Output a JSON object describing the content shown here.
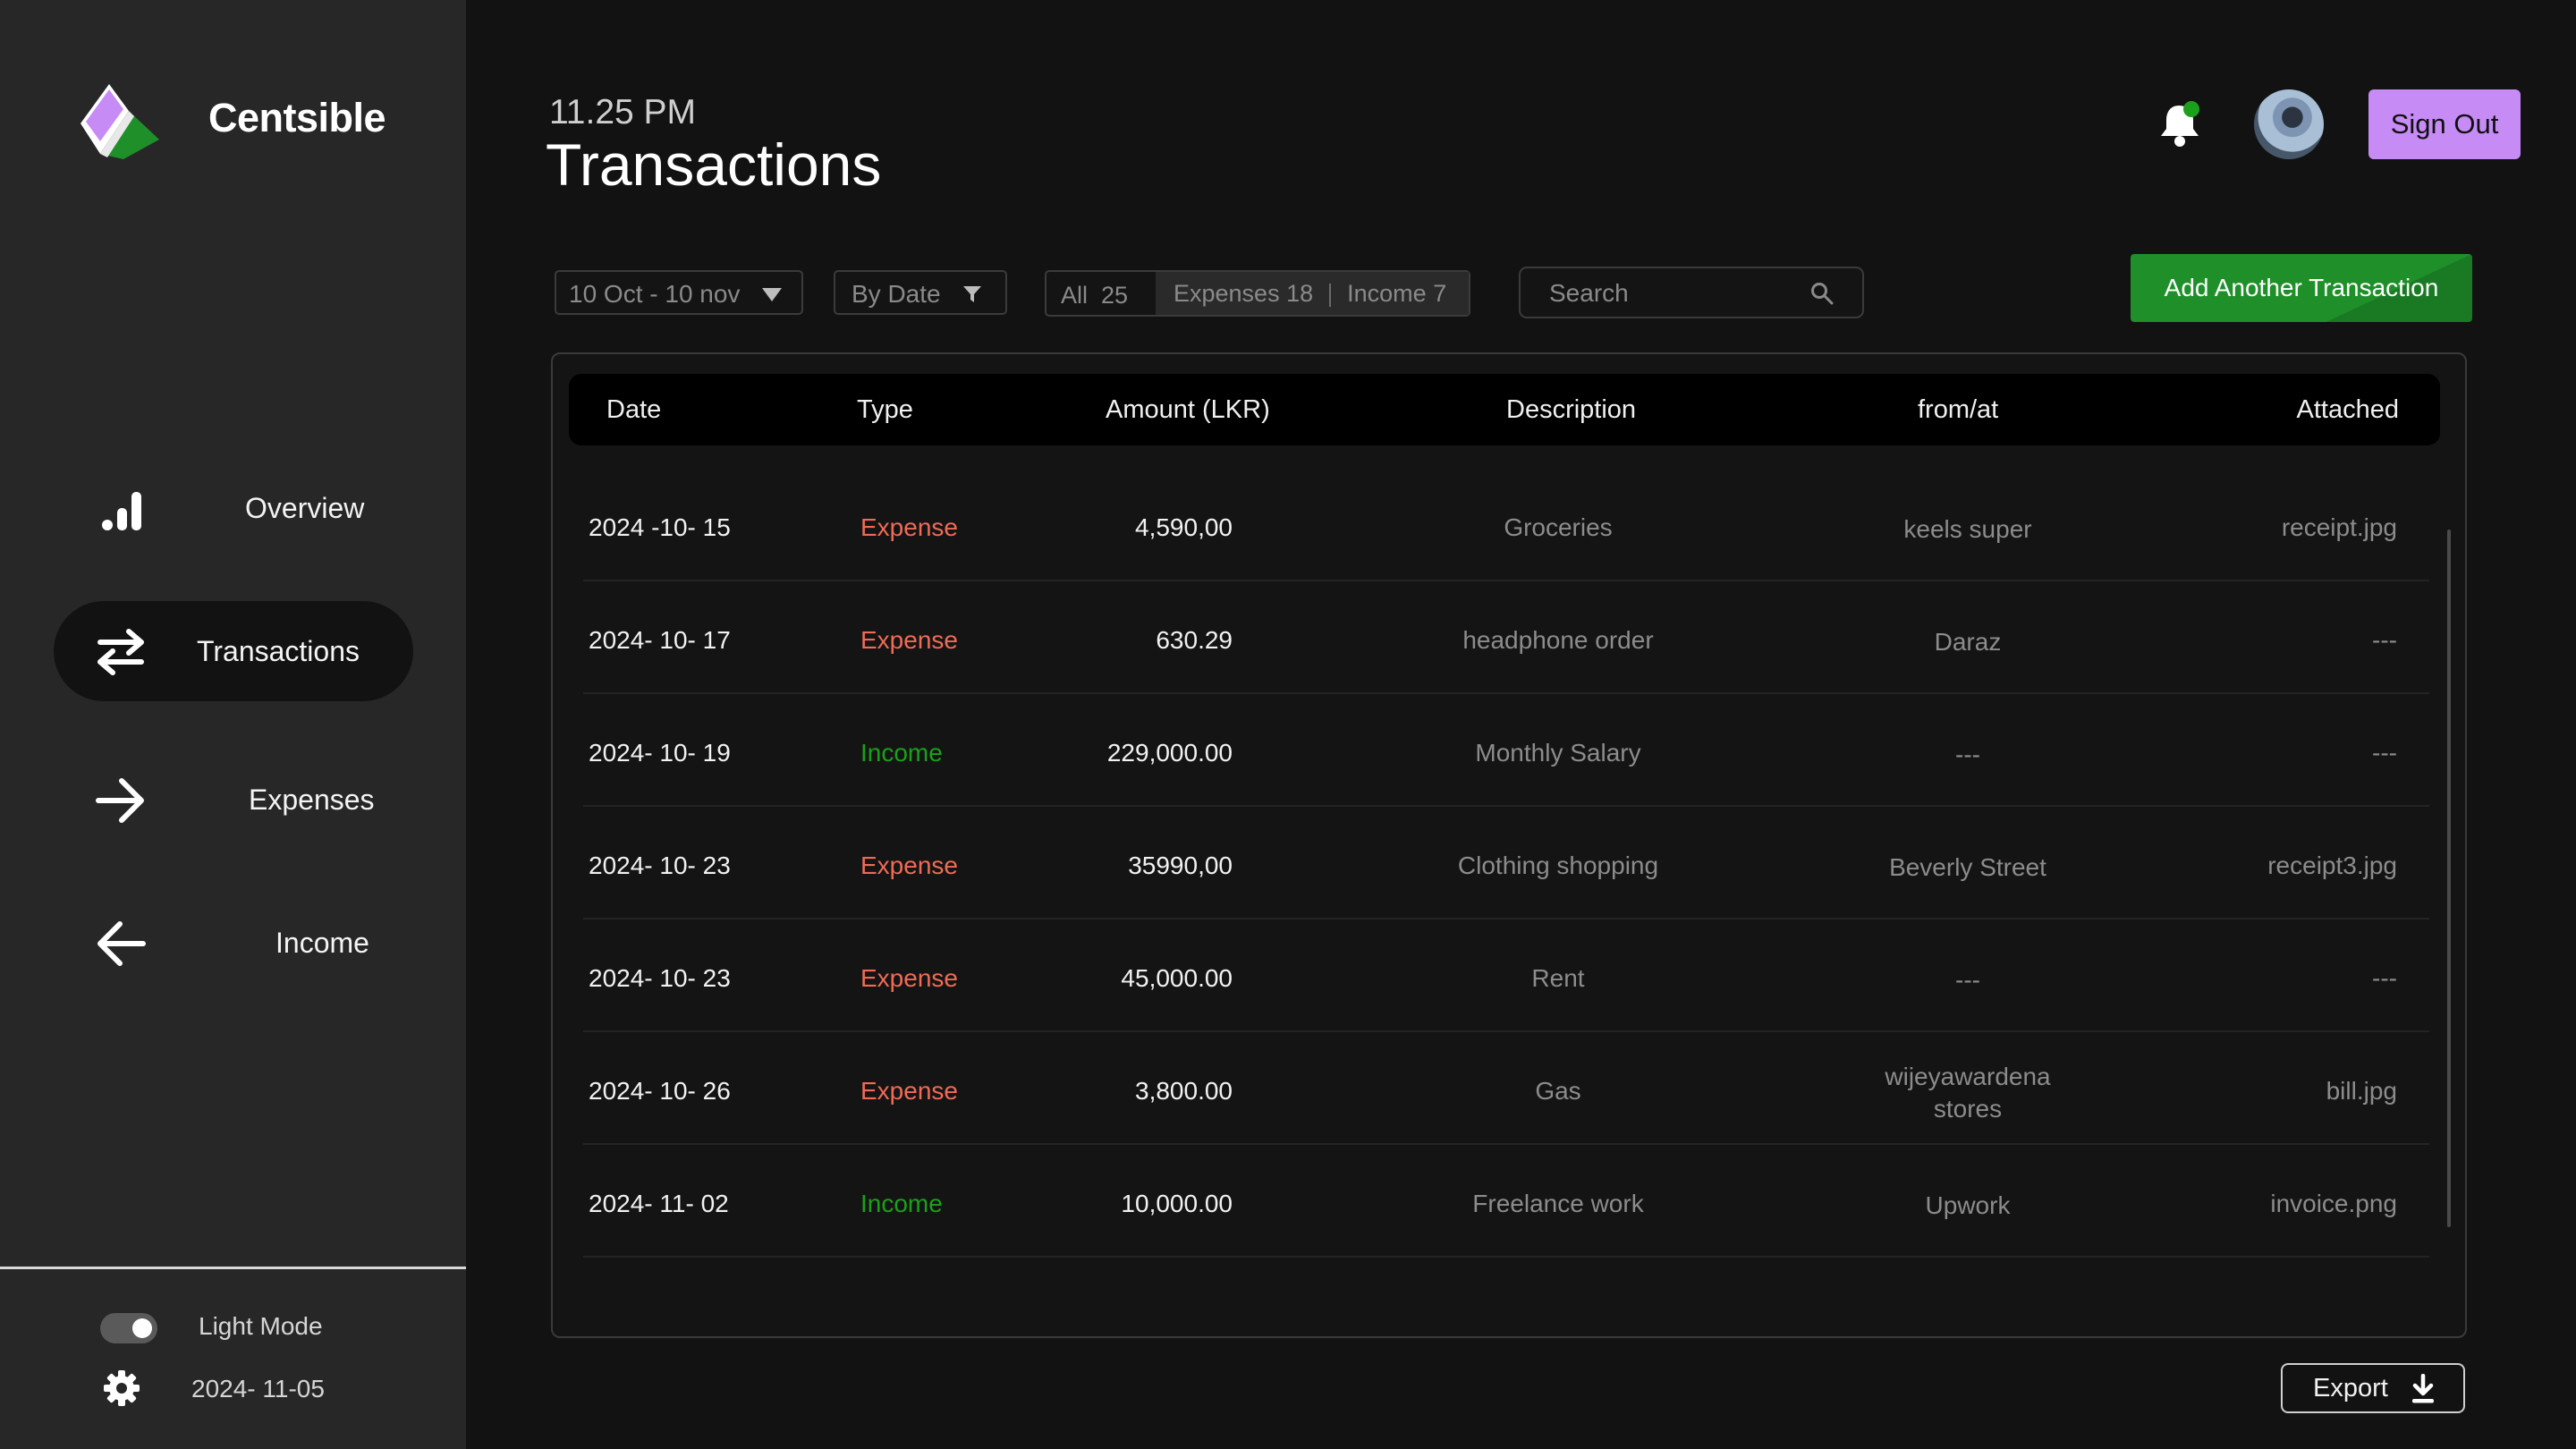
{
  "app": {
    "name": "Centsible"
  },
  "sidebar": {
    "nav": [
      {
        "label": "Overview",
        "icon": "bar-chart-icon"
      },
      {
        "label": "Transactions",
        "icon": "swap-arrows-icon",
        "active": true
      },
      {
        "label": "Expenses",
        "icon": "arrow-right-icon"
      },
      {
        "label": "Income",
        "icon": "arrow-left-icon"
      }
    ],
    "mode_label": "Light Mode",
    "date": "2024- 11-05"
  },
  "header": {
    "time": "11.25 PM",
    "title": "Transactions",
    "sign_out": "Sign Out"
  },
  "filters": {
    "date_range": "10 Oct - 10 nov",
    "sort": "By Date",
    "segments": {
      "all_label": "All",
      "all_count": "25",
      "expenses_label": "Expenses",
      "expenses_count": "18",
      "income_label": "Income",
      "income_count": "7"
    },
    "search_placeholder": "Search",
    "add_button": "Add Another Transaction"
  },
  "table": {
    "headers": {
      "date": "Date",
      "type": "Type",
      "amount": "Amount (LKR)",
      "description": "Description",
      "from": "from/at",
      "attached": "Attached"
    },
    "rows": [
      {
        "date": "2024 -10- 15",
        "type": "Expense",
        "amount": "4,590,00",
        "description": "Groceries",
        "from": "keels super",
        "attached": "receipt.jpg"
      },
      {
        "date": "2024- 10- 17",
        "type": "Expense",
        "amount": "630.29",
        "description": "headphone order",
        "from": "Daraz",
        "attached": "---"
      },
      {
        "date": "2024- 10- 19",
        "type": "Income",
        "amount": "229,000.00",
        "description": "Monthly Salary",
        "from": "---",
        "attached": "---"
      },
      {
        "date": "2024- 10- 23",
        "type": "Expense",
        "amount": "35990,00",
        "description": "Clothing shopping",
        "from": "Beverly Street",
        "attached": "receipt3.jpg"
      },
      {
        "date": "2024- 10- 23",
        "type": "Expense",
        "amount": "45,000.00",
        "description": "Rent",
        "from": "---",
        "attached": "---"
      },
      {
        "date": "2024- 10- 26",
        "type": "Expense",
        "amount": "3,800.00",
        "description": "Gas",
        "from": "wijeyawardena stores",
        "attached": "bill.jpg"
      },
      {
        "date": "2024- 11- 02",
        "type": "Income",
        "amount": "10,000.00",
        "description": "Freelance work",
        "from": "Upwork",
        "attached": "invoice.png"
      }
    ]
  },
  "export_label": "Export",
  "colors": {
    "accent_green": "#1f8f2a",
    "sign_out_purple": "#c78bf6",
    "expense_red": "#ef6b56",
    "income_green": "#1aa01a",
    "notification_dot": "#1aa01a"
  }
}
